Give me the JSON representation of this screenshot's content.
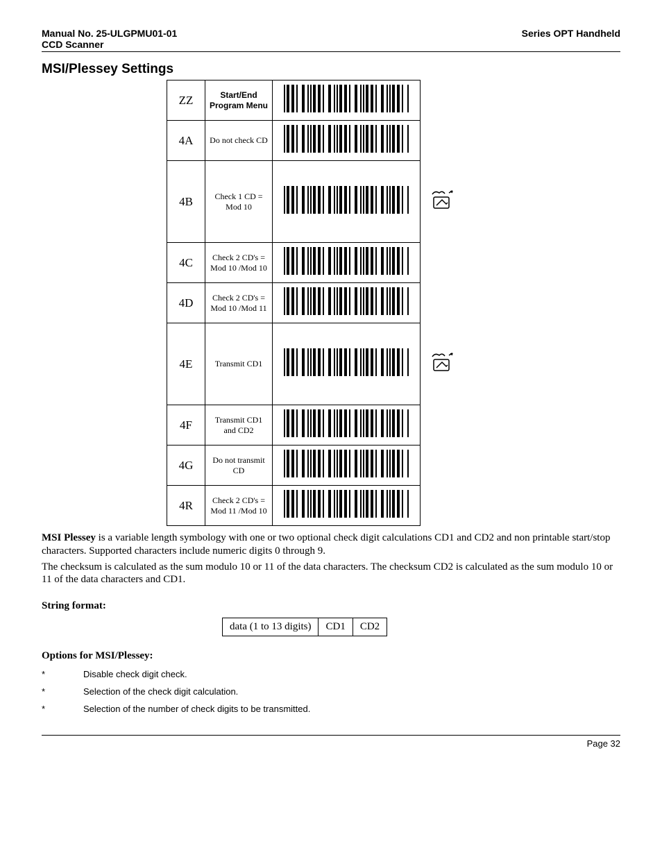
{
  "header": {
    "manual_no_label": "Manual No. 25-ULGPMU01-01",
    "series_label": "Series OPT Handheld",
    "device_label": "CCD Scanner"
  },
  "section_title": "MSI/Plessey Settings",
  "rows": [
    {
      "code": "ZZ",
      "desc": "Start/End Program Menu",
      "menu": true,
      "tall": false,
      "icon": false
    },
    {
      "code": "4A",
      "desc": "Do not check CD",
      "menu": false,
      "tall": false,
      "icon": false
    },
    {
      "code": "4B",
      "desc": "Check 1 CD = Mod 10",
      "menu": false,
      "tall": true,
      "icon": true
    },
    {
      "code": "4C",
      "desc": "Check 2 CD's = Mod 10 /Mod 10",
      "menu": false,
      "tall": false,
      "icon": false
    },
    {
      "code": "4D",
      "desc": "Check 2 CD's = Mod 10 /Mod 11",
      "menu": false,
      "tall": false,
      "icon": false
    },
    {
      "code": "4E",
      "desc": "Transmit CD1",
      "menu": false,
      "tall": true,
      "icon": true
    },
    {
      "code": "4F",
      "desc": "Transmit CD1 and CD2",
      "menu": false,
      "tall": false,
      "icon": false
    },
    {
      "code": "4G",
      "desc": "Do not transmit CD",
      "menu": false,
      "tall": false,
      "icon": false
    },
    {
      "code": "4R",
      "desc": "Check 2 CD's = Mod 11 /Mod 10",
      "menu": false,
      "tall": false,
      "icon": false
    }
  ],
  "paragraph": {
    "lead_bold": "MSI Plessey",
    "p1_rest": " is a variable length symbology with one or two optional check digit calculations CD1 and CD2 and non printable start/stop characters. Supported characters include numeric digits 0 through 9.",
    "p2": "The checksum is calculated as the sum modulo 10 or 11 of the data characters. The checksum CD2 is calculated as the sum modulo 10 or 11 of the data characters and CD1."
  },
  "string_format_label": "String format:",
  "format_table": {
    "c1": "data (1 to 13 digits)",
    "c2": "CD1",
    "c3": "CD2"
  },
  "options_label": "Options for MSI/Plessey:",
  "options": [
    "Disable check digit check.",
    "Selection of the check digit calculation.",
    "Selection of the number of check digits to be transmitted."
  ],
  "page_label": "Page 32"
}
